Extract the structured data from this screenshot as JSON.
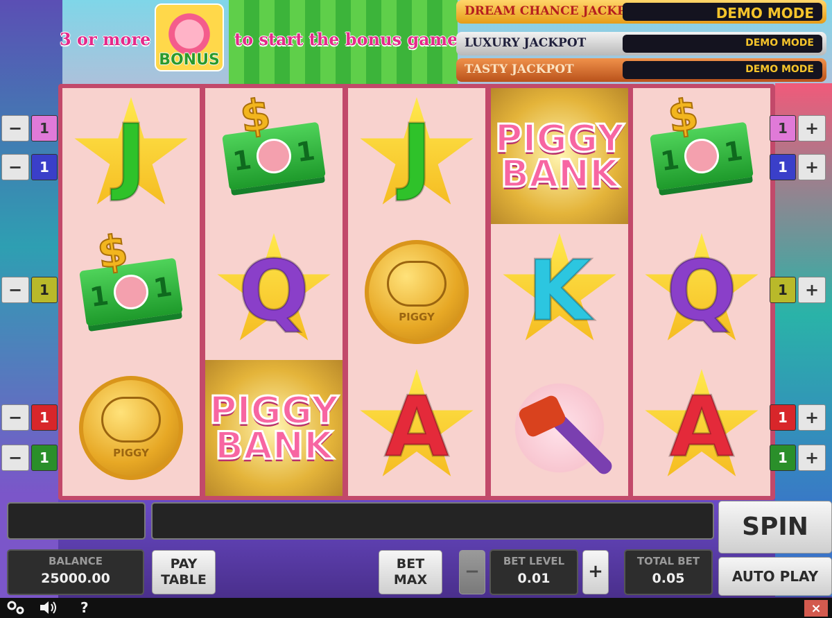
{
  "banner": {
    "left_text": "3 or more",
    "right_text": "to start the bonus game",
    "bonus_label": "BONUS"
  },
  "jackpots": [
    {
      "name": "DREAM CHANCE JACKPOT",
      "value": "DEMO MODE",
      "color": "#f5b221"
    },
    {
      "name": "LUXURY JACKPOT",
      "value": "DEMO MODE",
      "color": "#c9c9c9"
    },
    {
      "name": "TASTY JACKPOT",
      "value": "DEMO MODE",
      "color": "#d8722e"
    }
  ],
  "reels": [
    [
      {
        "sym": "J"
      },
      {
        "sym": "cash"
      },
      {
        "sym": "coin",
        "text": "PIGGY"
      }
    ],
    [
      {
        "sym": "cash"
      },
      {
        "sym": "Q"
      },
      {
        "sym": "logo",
        "text": "PIGGY BANK"
      }
    ],
    [
      {
        "sym": "J"
      },
      {
        "sym": "coin",
        "text": "PIGGY"
      },
      {
        "sym": "A"
      }
    ],
    [
      {
        "sym": "logo",
        "text": "PIGGY BANK"
      },
      {
        "sym": "K"
      },
      {
        "sym": "hammer"
      }
    ],
    [
      {
        "sym": "cash"
      },
      {
        "sym": "Q"
      },
      {
        "sym": "A"
      }
    ]
  ],
  "lines": {
    "left": [
      {
        "minus": "−",
        "num": "1",
        "color": "#e07ad8"
      },
      {
        "minus": "−",
        "num": "1",
        "color": "#3a3fc9"
      },
      {
        "minus": "−",
        "num": "1",
        "color": "#b9b92a"
      },
      {
        "minus": "−",
        "num": "1",
        "color": "#d8262a"
      },
      {
        "minus": "−",
        "num": "1",
        "color": "#2a8f2a"
      }
    ],
    "right": [
      {
        "num": "1",
        "plus": "+",
        "color": "#e07ad8"
      },
      {
        "num": "1",
        "plus": "+",
        "color": "#3a3fc9"
      },
      {
        "num": "1",
        "plus": "+",
        "color": "#b9b92a"
      },
      {
        "num": "1",
        "plus": "+",
        "color": "#d8262a"
      },
      {
        "num": "1",
        "plus": "+",
        "color": "#2a8f2a"
      }
    ]
  },
  "controls": {
    "spin": "SPIN",
    "auto_play": "AUTO PLAY",
    "balance_label": "BALANCE",
    "balance_value": "25000.00",
    "pay_table": "PAY TABLE",
    "bet_max": "BET MAX",
    "minus": "−",
    "plus": "+",
    "bet_level_label": "BET LEVEL",
    "bet_level_value": "0.01",
    "total_bet_label": "TOTAL BET",
    "total_bet_value": "0.05"
  },
  "statusbar": {
    "settings_icon": "gear-icon",
    "sound_icon": "speaker-icon",
    "help": "?",
    "close": "×"
  }
}
